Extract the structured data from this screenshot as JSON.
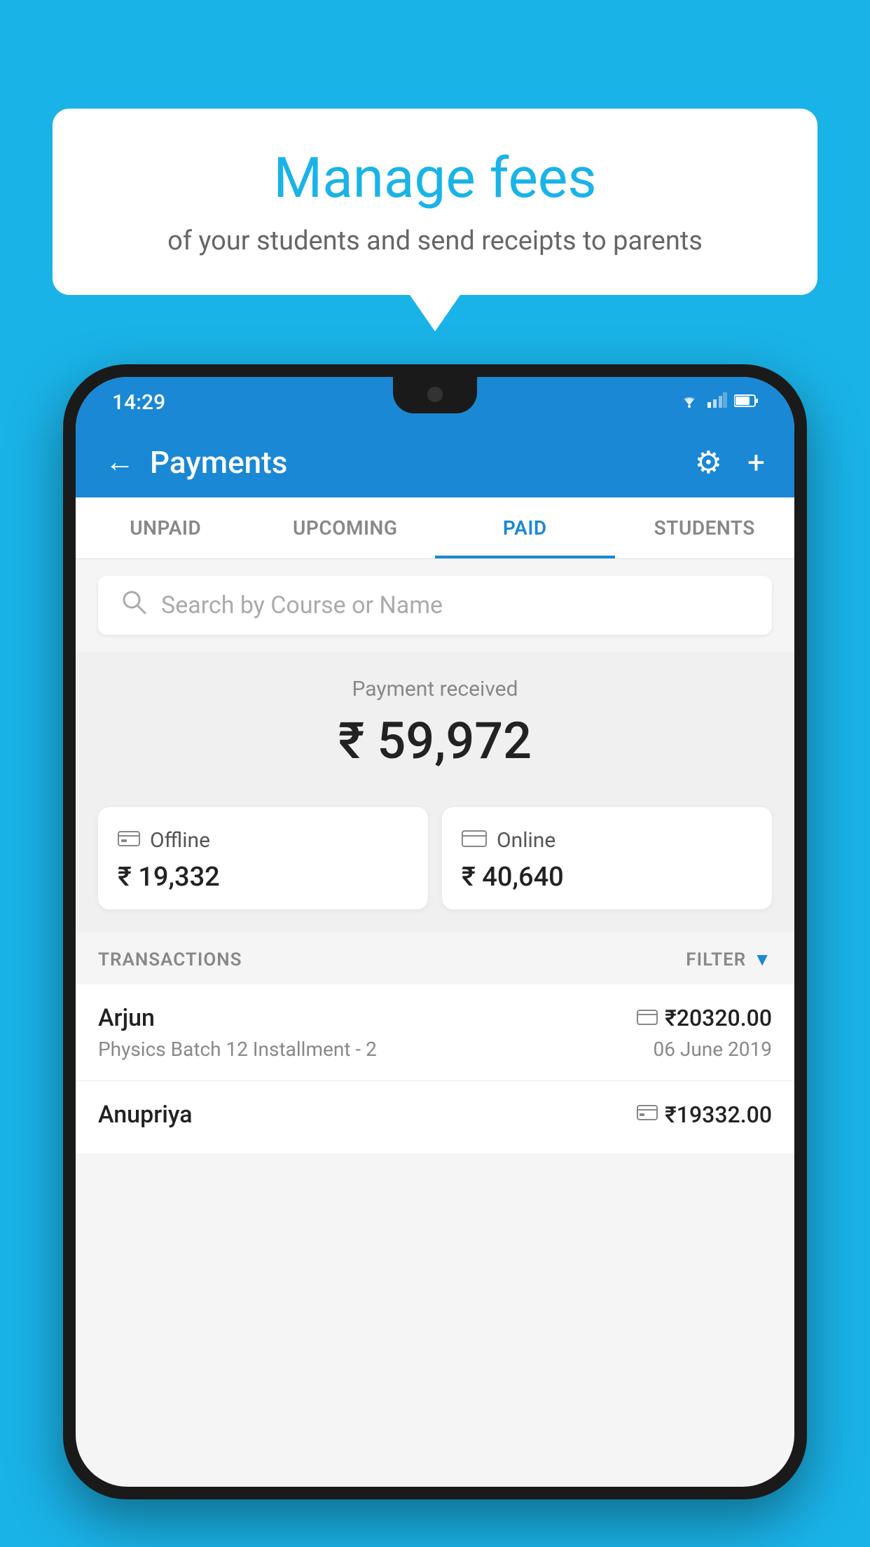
{
  "background_color": "#1ab3e8",
  "speech_bubble": {
    "title": "Manage fees",
    "subtitle": "of your students and send receipts to parents"
  },
  "phone": {
    "status_bar": {
      "time": "14:29",
      "wifi_icon": "▼▲",
      "signal_icon": "▲",
      "battery_icon": "▐"
    },
    "header": {
      "title": "Payments",
      "back_label": "←",
      "settings_icon": "⚙",
      "add_icon": "+"
    },
    "tabs": [
      {
        "id": "unpaid",
        "label": "UNPAID",
        "active": false
      },
      {
        "id": "upcoming",
        "label": "UPCOMING",
        "active": false
      },
      {
        "id": "paid",
        "label": "PAID",
        "active": true
      },
      {
        "id": "students",
        "label": "STUDENTS",
        "active": false
      }
    ],
    "search": {
      "placeholder": "Search by Course or Name"
    },
    "payment_summary": {
      "label": "Payment received",
      "amount": "₹ 59,972",
      "offline": {
        "label": "Offline",
        "amount": "₹ 19,332"
      },
      "online": {
        "label": "Online",
        "amount": "₹ 40,640"
      }
    },
    "transactions": {
      "header_label": "TRANSACTIONS",
      "filter_label": "FILTER",
      "items": [
        {
          "name": "Arjun",
          "course": "Physics Batch 12 Installment - 2",
          "amount": "₹20320.00",
          "date": "06 June 2019",
          "payment_type": "online"
        },
        {
          "name": "Anupriya",
          "course": "",
          "amount": "₹19332.00",
          "date": "",
          "payment_type": "offline"
        }
      ]
    }
  }
}
